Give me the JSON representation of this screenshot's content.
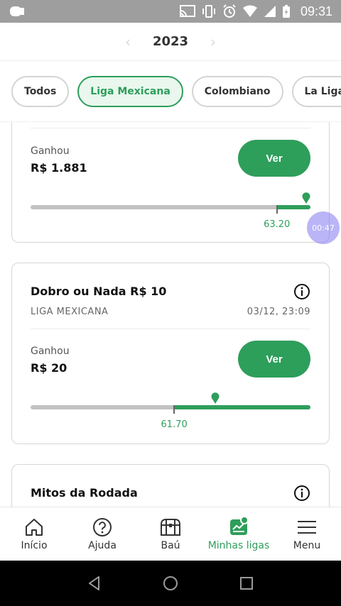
{
  "status_bar": {
    "time": "09:31"
  },
  "year_selector": {
    "year": "2023",
    "prev_icon": "chevron-left-icon",
    "next_icon": "chevron-right-icon"
  },
  "filters": [
    {
      "label": "Todos",
      "active": false
    },
    {
      "label": "Liga Mexicana",
      "active": true
    },
    {
      "label": "Colombiano",
      "active": false
    },
    {
      "label": "La Liga",
      "active": false
    }
  ],
  "cards": [
    {
      "title": "",
      "league": "",
      "date": "",
      "won_label": "Ganhou",
      "won_value": "R$ 1.881",
      "button": "Ver",
      "score": "63.20",
      "progress": {
        "cutoff_fraction": 0.88,
        "pin_fraction": 0.985
      }
    },
    {
      "title": "Dobro ou Nada R$ 10",
      "league": "LIGA MEXICANA",
      "date": "03/12, 23:09",
      "won_label": "Ganhou",
      "won_value": "R$ 20",
      "button": "Ver",
      "score": "61.70",
      "progress": {
        "cutoff_fraction": 0.513,
        "pin_fraction": 0.66
      }
    },
    {
      "title": "Mitos da Rodada"
    }
  ],
  "timer": "00:47",
  "bottom_nav": [
    {
      "label": "Início",
      "icon": "home-icon",
      "active": false
    },
    {
      "label": "Ajuda",
      "icon": "help-icon",
      "active": false
    },
    {
      "label": "Baú",
      "icon": "chest-icon",
      "active": false
    },
    {
      "label": "Minhas ligas",
      "icon": "my-leagues-icon",
      "active": true
    },
    {
      "label": "Menu",
      "icon": "menu-icon",
      "active": false
    }
  ],
  "colors": {
    "accent": "#2e9e5b",
    "accent_light": "#e9f7ee",
    "track": "#c2c2c2"
  }
}
